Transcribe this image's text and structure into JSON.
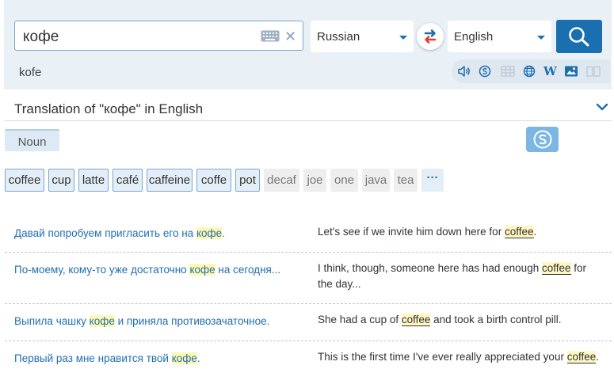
{
  "search": {
    "query": "кофе",
    "transliteration": "kofe"
  },
  "languages": {
    "source": "Russian",
    "target": "English"
  },
  "toolbar": {
    "icons": [
      "speaker-icon",
      "speak-s-icon",
      "table-icon",
      "globe-icon",
      "wikipedia-icon",
      "image-icon",
      "book-icon"
    ],
    "wiki_letter": "W"
  },
  "result": {
    "heading": "Translation of \"кофе\" in English",
    "pos_tab": "Noun"
  },
  "translations": {
    "primary": [
      "coffee",
      "cup",
      "latte",
      "café",
      "caffeine",
      "coffe",
      "pot"
    ],
    "secondary": [
      "decaf",
      "joe",
      "one",
      "java",
      "tea"
    ],
    "more": "···"
  },
  "examples": [
    {
      "src_before": "Давай попробуем пригласить его на ",
      "src_hl": "кофе",
      "src_after": ".",
      "tgt_before": "Let's see if we invite him down here for ",
      "tgt_hl": "coffee",
      "tgt_after": "."
    },
    {
      "src_before": "По-моему, кому-то уже достаточно ",
      "src_hl": "кофе",
      "src_after": " на сегодня...",
      "tgt_before": "I think, though, someone here has had enough ",
      "tgt_hl": "coffee",
      "tgt_after": " for the day..."
    },
    {
      "src_before": "Выпила чашку ",
      "src_hl": "кофе",
      "src_after": " и приняла противозачаточное.",
      "tgt_before": "She had a cup of ",
      "tgt_hl": "coffee",
      "tgt_after": " and took a birth control pill."
    },
    {
      "src_before": "Первый раз мне нравится твой ",
      "src_hl": "кофе",
      "src_after": ".",
      "tgt_before": "This is the first time I've ever really appreciated your ",
      "tgt_hl": "coffee",
      "tgt_after": "."
    }
  ],
  "colors": {
    "accent": "#1a6fb0",
    "highlight": "#fff8b3",
    "header_bg": "#e9f0f6"
  }
}
